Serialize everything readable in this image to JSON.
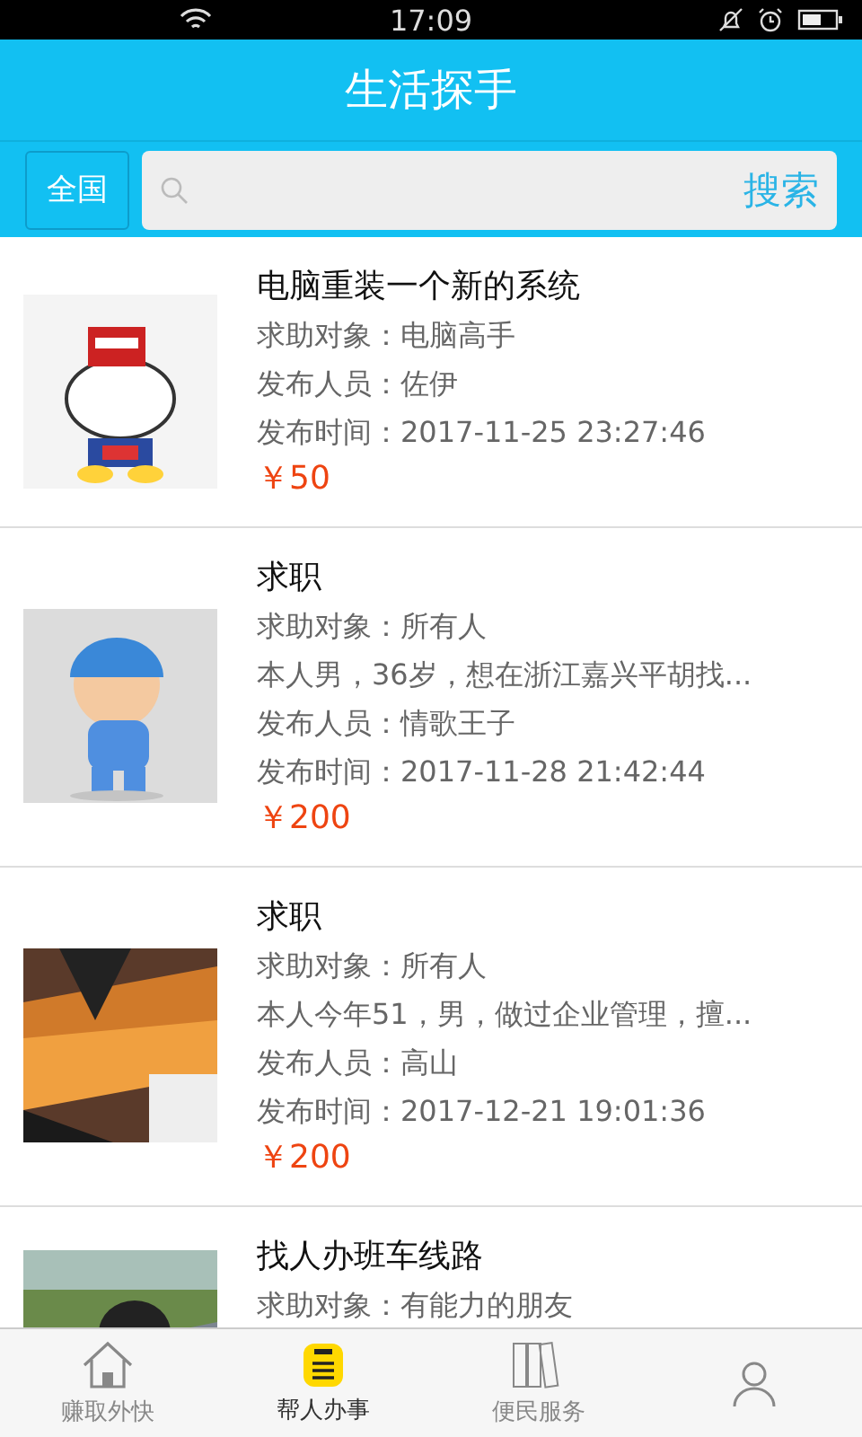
{
  "status_bar": {
    "time": "17:09"
  },
  "header": {
    "title": "生活探手"
  },
  "search": {
    "region": "全国",
    "button": "搜索"
  },
  "posts": [
    {
      "title": "电脑重装一个新的系统",
      "target": "求助对象：电脑高手",
      "publisher": "发布人员：佐伊",
      "time": "发布时间：2017-11-25 23:27:46",
      "price": "￥50"
    },
    {
      "title": "求职",
      "target": "求助对象：所有人",
      "description": "本人男，36岁，想在浙江嘉兴平胡找...",
      "publisher": "发布人员：情歌王子",
      "time": "发布时间：2017-11-28 21:42:44",
      "price": "￥200"
    },
    {
      "title": "求职",
      "target": "求助对象：所有人",
      "description": "本人今年51，男，做过企业管理，擅...",
      "publisher": "发布人员：高山",
      "time": "发布时间：2017-12-21 19:01:36",
      "price": "￥200"
    },
    {
      "title": "找人办班车线路",
      "target": "求助对象：有能力的朋友"
    }
  ],
  "tab_bar": [
    {
      "label": "赚取外快",
      "selected": false
    },
    {
      "label": "帮人办事",
      "selected": true
    },
    {
      "label": "便民服务",
      "selected": false
    },
    {
      "selected": false
    }
  ]
}
